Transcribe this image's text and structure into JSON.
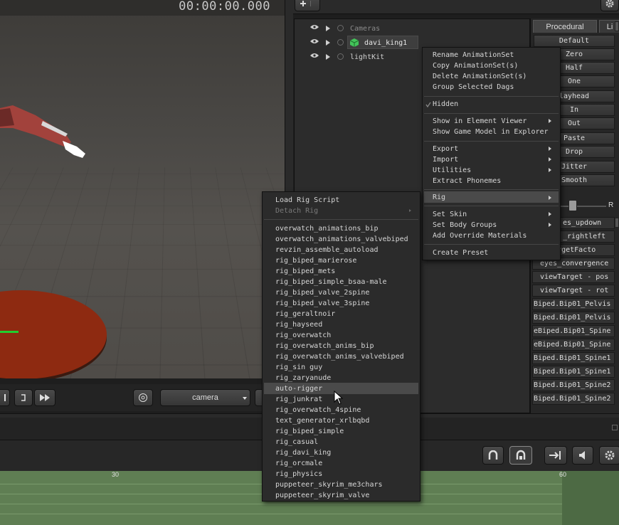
{
  "viewport": {
    "timecode": "00:00:00.000",
    "camera_select": "camera"
  },
  "outliner": {
    "rows": [
      {
        "label": "Cameras",
        "muted": true
      },
      {
        "label": "davi_king1",
        "selected": true
      },
      {
        "label": "lightKit"
      }
    ]
  },
  "right_panel": {
    "tabs": [
      "Procedural",
      "Li"
    ],
    "buttons": [
      "Default",
      "Zero",
      "Half",
      "One",
      "layhead",
      "In",
      "Out",
      "Paste",
      "Drop",
      "Jitter",
      "Smooth"
    ],
    "slider_right_label": "R",
    "rows": [
      "es_updown",
      "_rightleft",
      "ewTargetFacto",
      "eyes_convergence",
      "viewTarget - pos",
      "viewTarget - rot",
      "Biped.Bip01_Pelvis",
      "Biped.Bip01_Pelvis",
      "eBiped.Bip01_Spine",
      "eBiped.Bip01_Spine",
      "Biped.Bip01_Spine1",
      "Biped.Bip01_Spine1",
      "Biped.Bip01_Spine2",
      "Biped.Bip01_Spine2"
    ]
  },
  "context_menu": {
    "groups": [
      [
        "Rename AnimationSet",
        "Copy AnimationSet(s)",
        "Delete AnimationSet(s)",
        "Group Selected Dags"
      ],
      [
        "Hidden"
      ],
      [
        "Show in Element Viewer",
        "Show Game Model in Explorer"
      ],
      [
        "Export",
        "Import",
        "Utilities",
        "Extract Phonemes"
      ],
      [
        "Rig"
      ],
      [
        "Set Skin",
        "Set Body Groups",
        "Add Override Materials"
      ],
      [
        "Create Preset"
      ]
    ],
    "submenu_items": [
      "Show in Element Viewer",
      "Export",
      "Import",
      "Utilities",
      "Rig",
      "Set Skin",
      "Set Body Groups"
    ],
    "checked_item": "Hidden",
    "highlighted_item": "Rig"
  },
  "rig_submenu": {
    "header": [
      "Load Rig Script",
      "Detach Rig"
    ],
    "disabled": [
      "Detach Rig"
    ],
    "scripts": [
      "overwatch_animations_bip",
      "overwatch_animations_valvebiped",
      "revzin_assemble_autoload",
      "rig_biped_marierose",
      "rig_biped_mets",
      "rig_biped_simple_bsaa-male",
      "rig_biped_valve_2spine",
      "rig_biped_valve_3spine",
      "rig_geraltnoir",
      "rig_hayseed",
      "rig_overwatch",
      "rig_overwatch_anims_bip",
      "rig_overwatch_anims_valvebiped",
      "rig_sin guy",
      "rig_zaryanude",
      "auto-rigger",
      "rig_junkrat",
      "rig_overwatch_4spine",
      "text_generator_xrlbqbd",
      "rig_biped_simple",
      "rig_casual",
      "rig_davi_king",
      "rig_orcmale",
      "rig_physics",
      "puppeteer_skyrim_me3chars",
      "puppeteer_skyrim_valve"
    ],
    "hovered": "auto-rigger"
  },
  "timeline": {
    "ticks": [
      "30",
      "60"
    ]
  },
  "colors": {
    "disc": "#8e2a11",
    "timeline": "#5f7e53",
    "menu_bg": "#2b2b2b",
    "highlight": "#4a4a4a"
  }
}
